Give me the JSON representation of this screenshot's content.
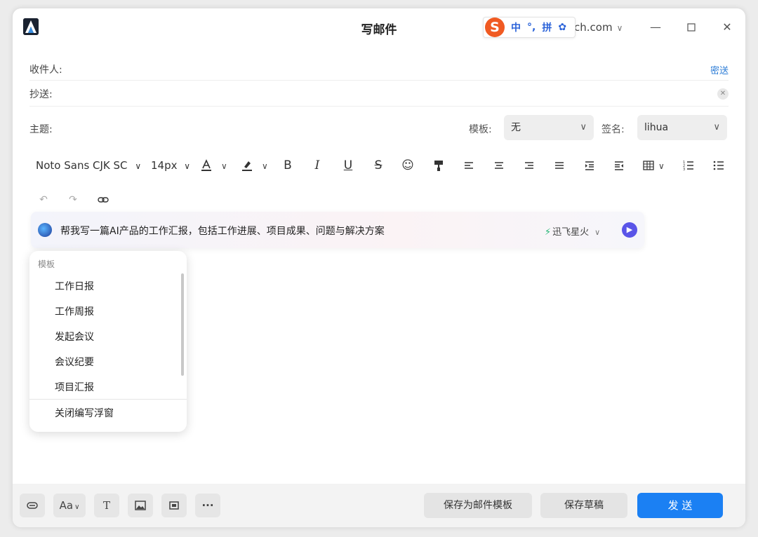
{
  "window": {
    "title": "写邮件",
    "account_suffix": "ch.com"
  },
  "ime": {
    "logo": "S",
    "mode": "中",
    "punct": "°,",
    "input": "拼",
    "settings": "✿"
  },
  "fields": {
    "to_label": "收件人:",
    "bcc_link": "密送",
    "cc_label": "抄送:",
    "subject_label": "主题:",
    "template_label": "模板:",
    "template_value": "无",
    "signature_label": "签名:",
    "signature_value": "lihua"
  },
  "toolbar": {
    "font_family": "Noto Sans CJK SC",
    "font_size": "14px"
  },
  "ai": {
    "prompt": "帮我写一篇AI产品的工作汇报，包括工作进展、项目成果、问题与解决方案",
    "model": "迅飞星火"
  },
  "template_menu": {
    "header": "模板",
    "items": [
      "工作日报",
      "工作周报",
      "发起会议",
      "会议纪要",
      "项目汇报"
    ],
    "close": "关闭编写浮窗"
  },
  "bottom": {
    "font_btn": "Aa",
    "text_btn": "T",
    "more_btn": "···",
    "save_template": "保存为邮件模板",
    "save_draft": "保存草稿",
    "send": "发 送"
  },
  "colors": {
    "accent": "#1b80f3",
    "bcc_link": "#2a7bd6",
    "ai_send": "#5a55e8",
    "ime_logo": "#f05a22"
  }
}
